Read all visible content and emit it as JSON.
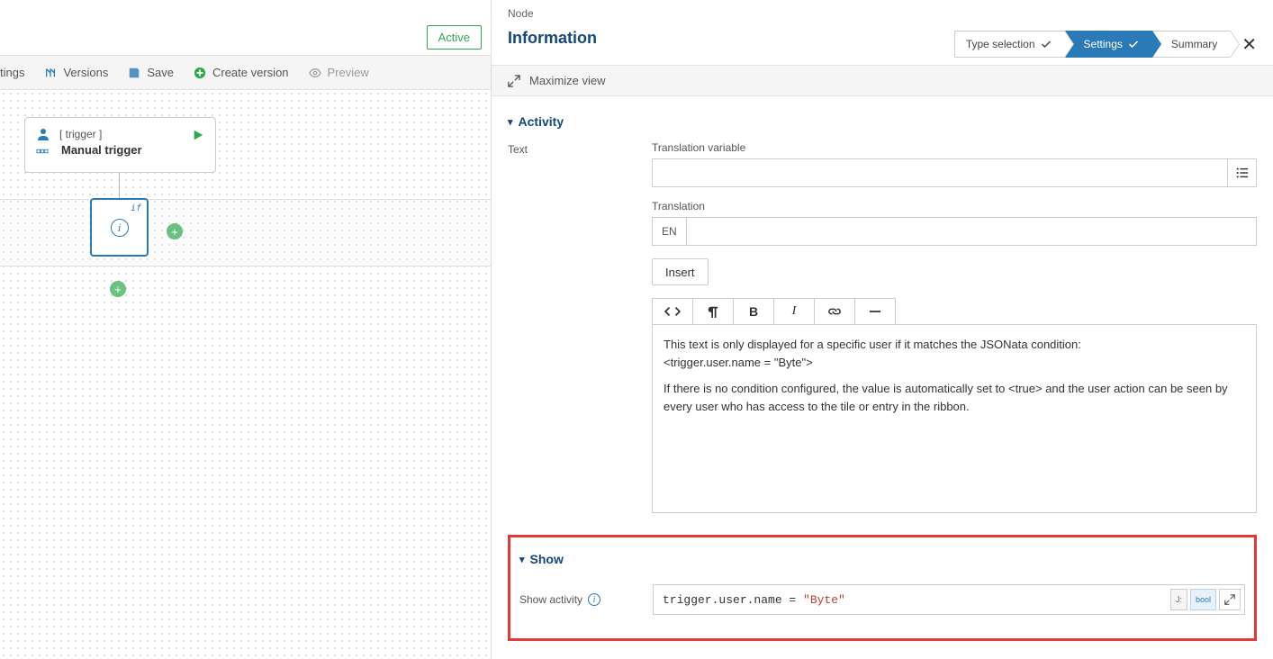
{
  "leftPanel": {
    "activeBadge": "Active",
    "toolbar": {
      "settings": "tings",
      "versions": "Versions",
      "save": "Save",
      "createVersion": "Create version",
      "preview": "Preview"
    },
    "triggerNode": {
      "label": "[ trigger ]",
      "title": "Manual trigger"
    },
    "ifNode": {
      "label": "if"
    }
  },
  "rightPanel": {
    "nodeLabel": "Node",
    "title": "Information",
    "wizard": {
      "typeSelection": "Type selection",
      "settings": "Settings",
      "summary": "Summary"
    },
    "maximize": "Maximize view",
    "activity": {
      "header": "Activity",
      "textLabel": "Text",
      "translationVarLabel": "Translation variable",
      "translationVarValue": "",
      "translationLabel": "Translation",
      "langBadge": "EN",
      "translationValue": "",
      "insertBtn": "Insert",
      "content": {
        "p1": "This text is only displayed for a specific user if it matches the JSONata condition:",
        "p2": "<trigger.user.name = \"Byte\">",
        "p3": "If there is no condition configured, the value is automatically set to <true> and the user action can be seen by every user who has access to the tile or entry in the ribbon."
      }
    },
    "show": {
      "header": "Show",
      "label": "Show activity",
      "codePath": "trigger.user.name",
      "codeOp": " = ",
      "codeStr": "\"Byte\"",
      "btnJ": "J:",
      "btnBool": "bool"
    }
  }
}
